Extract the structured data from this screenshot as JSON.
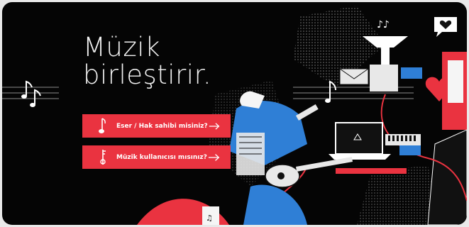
{
  "hero": {
    "headline_line1": "Müzik",
    "headline_line2": "birleştirir."
  },
  "buttons": {
    "rights_holder_label": "Eser / Hak sahibi misiniz?",
    "music_user_label": "Müzik kullanıcısı mısınız?"
  },
  "icons": {
    "rights_holder": "note-pen-icon",
    "music_user": "key-note-icon",
    "arrow": "arrow-right-icon",
    "favorite": "heart-chat-icon"
  },
  "colors": {
    "background": "#050505",
    "accent_red": "#ea3340",
    "blue": "#2f7fd6",
    "white": "#ffffff"
  }
}
